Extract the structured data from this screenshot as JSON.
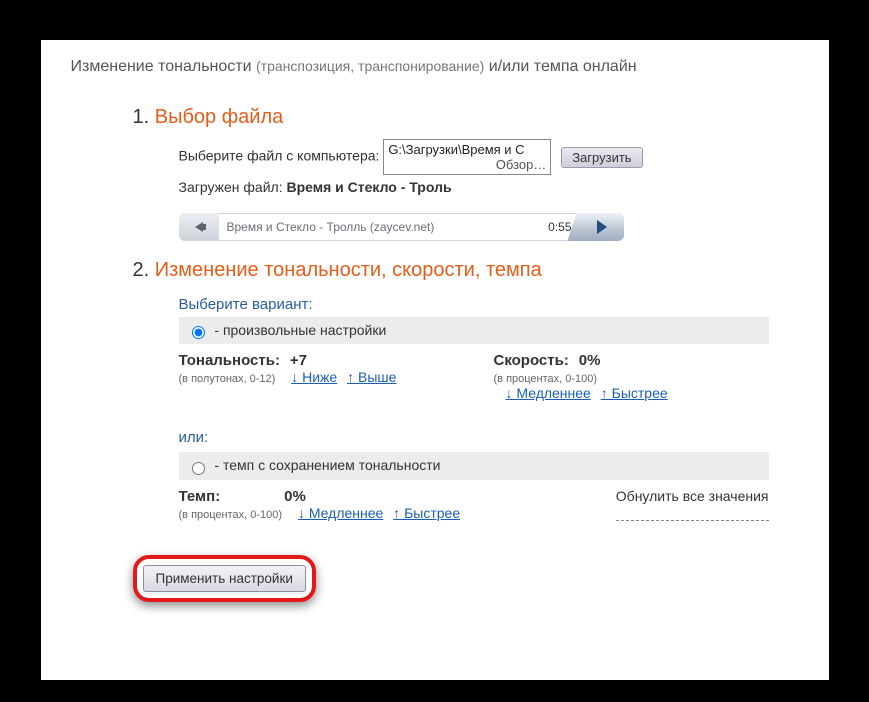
{
  "header": {
    "main": "Изменение тональности",
    "sub": "(транспозиция, транспонирование)",
    "tail": "и/или темпа онлайн"
  },
  "section1": {
    "num": "1.",
    "title": "Выбор файла",
    "choose_label": "Выберите файл с компьютера:",
    "file_path": "G:\\Загрузки\\Время и С",
    "browse": "Обзор…",
    "upload_btn": "Загрузить",
    "loaded_label": "Загружен файл:",
    "loaded_name": "Время и Стекло - Троль",
    "player_title": "Время и Стекло - Тролль (zaycev.net)",
    "player_time": "0:55"
  },
  "section2": {
    "num": "2.",
    "title": "Изменение тональности, скорости, темпа",
    "choose_variant": "Выберите вариант:",
    "opt_custom": " - произвольные настройки",
    "opt_tempo": " - темп с сохранением тональности",
    "tone_label": "Тональность:",
    "tone_val": "+7",
    "tone_note": "(в полутонах, 0-12)",
    "lower": "↓ Ниже",
    "higher": "↑ Выше",
    "speed_label": "Скорость:",
    "speed_val": "0%",
    "speed_note": "(в процентах, 0-100)",
    "slower": "↓ Медленнее",
    "faster": "↑ Быстрее",
    "or": "или:",
    "tempo_label": "Темп:",
    "tempo_val": "0%",
    "tempo_note": "(в процентах, 0-100)",
    "reset": "Обнулить все значения"
  },
  "apply": "Применить настройки"
}
